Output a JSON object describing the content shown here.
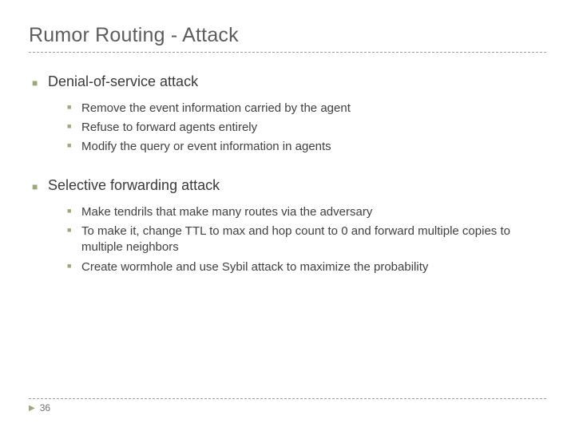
{
  "title": "Rumor Routing - Attack",
  "sections": [
    {
      "heading": "Denial-of-service attack",
      "items": [
        "Remove the event information carried by the agent",
        "Refuse to forward agents entirely",
        "Modify the query or event information in agents"
      ]
    },
    {
      "heading": "Selective forwarding attack",
      "items": [
        "Make tendrils that make many routes via the adversary",
        "To make it, change TTL to max and hop count to 0 and forward multiple copies to multiple neighbors",
        "Create wormhole and use Sybil attack to maximize the probability"
      ]
    }
  ],
  "page_number": "36"
}
